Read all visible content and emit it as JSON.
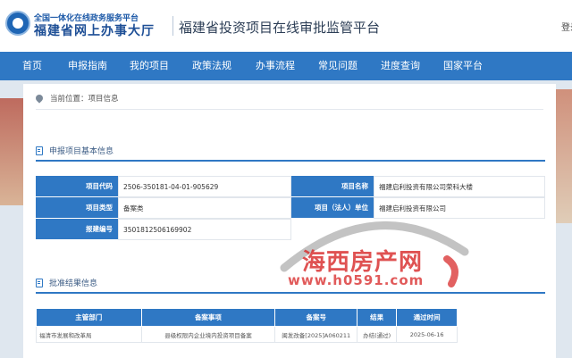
{
  "header": {
    "logo_line1": "全国一体化在线政务服务平台",
    "logo_line2": "福建省网上办事大厅",
    "platform_title": "福建省投资项目在线审批监管平台",
    "login": "登录"
  },
  "nav": {
    "items": [
      "首页",
      "申报指南",
      "我的项目",
      "政策法规",
      "办事流程",
      "常见问题",
      "进度查询",
      "国家平台"
    ]
  },
  "breadcrumb": "当前位置：项目信息",
  "basic_info": {
    "title": "申报项目基本信息",
    "project_code_label": "项目代码",
    "project_code": "2506-350181-04-01-905629",
    "project_name_label": "项目名称",
    "project_name": "福建启利投资有限公司荣科大楼",
    "project_type_label": "项目类型",
    "project_type": "备案类",
    "legal_unit_label": "项目（法人）单位",
    "legal_unit": "福建启利投资有限公司",
    "report_no_label": "报建编号",
    "report_no": "3501812506169902"
  },
  "approval": {
    "title": "批准结果信息",
    "columns": [
      "主管部门",
      "备案事项",
      "备案号",
      "结果",
      "通过时间"
    ],
    "rows": [
      [
        "福清市发展和改革局",
        "县级权限内企业境内投资项目备案",
        "闽发改备[2025]A060211",
        "办结(通过)",
        "2025-06-16"
      ]
    ]
  },
  "watermark": {
    "text": "海西房产网",
    "url": "www.h0591.com"
  },
  "colors": {
    "nav": "#2f78c4",
    "label_bg": "#2f78c4",
    "watermark": "#d82c2c"
  }
}
